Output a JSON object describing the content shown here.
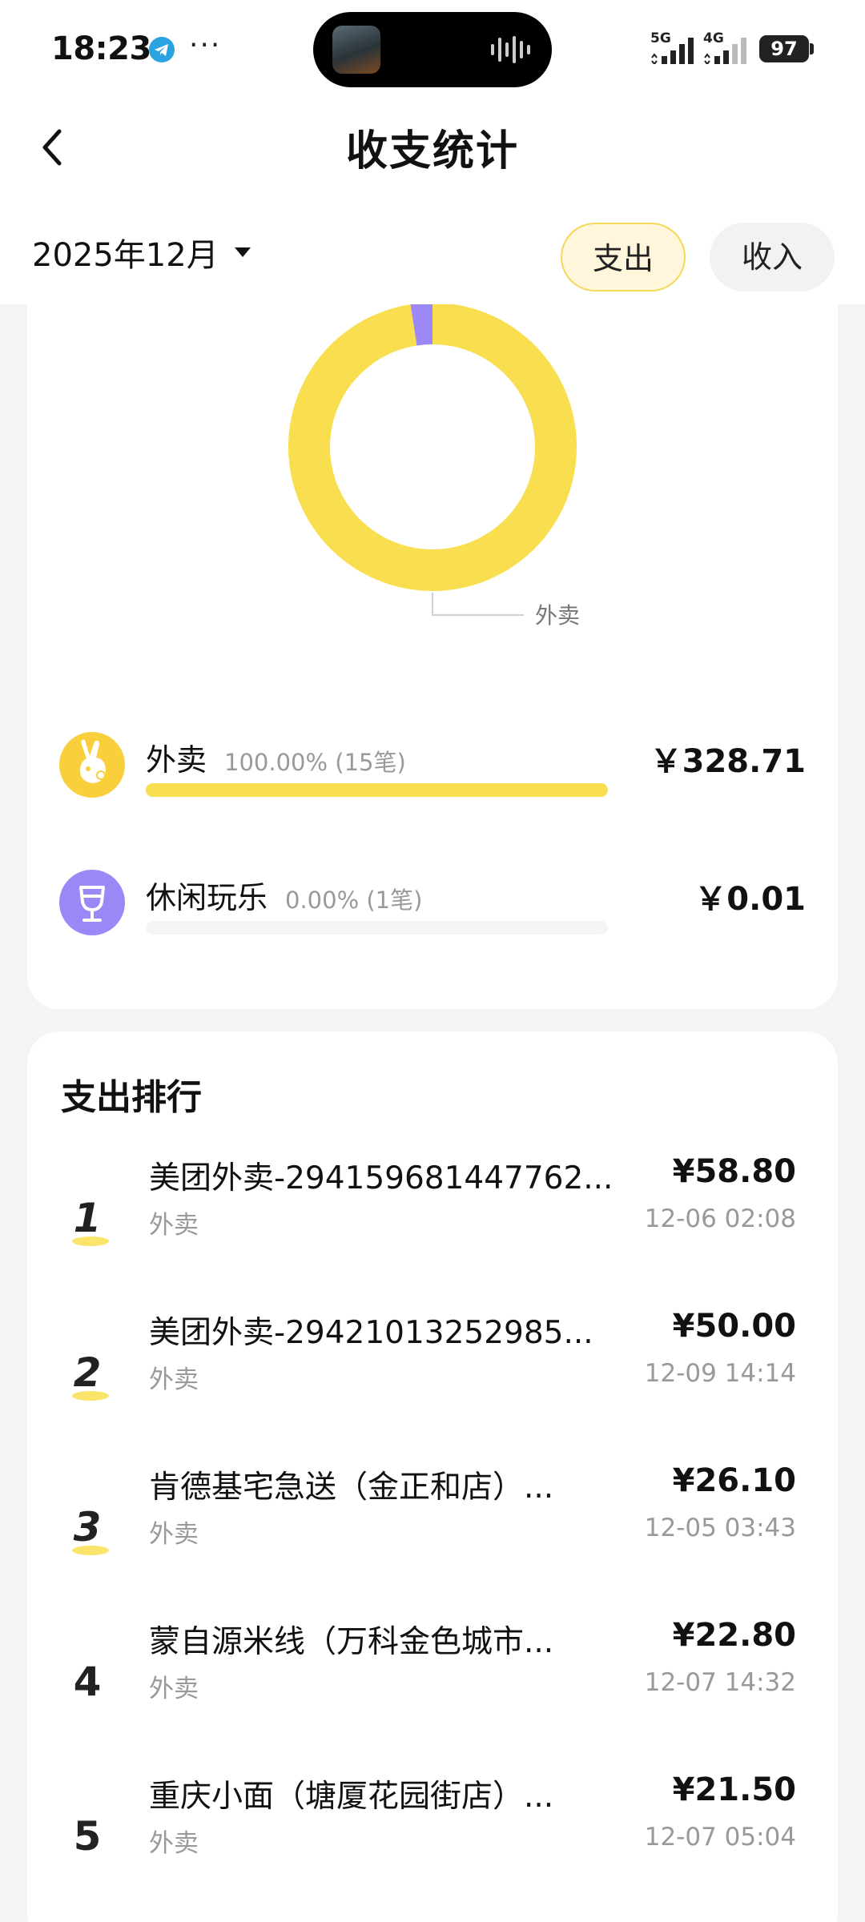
{
  "status_bar": {
    "time": "18:23",
    "dots": "···",
    "signal_1": "5G",
    "signal_2": "4G",
    "battery": "97"
  },
  "header": {
    "title": "收支统计",
    "month": "2025年12月",
    "tabs": [
      {
        "label": "支出",
        "selected": true
      },
      {
        "label": "收入",
        "selected": false
      }
    ]
  },
  "chart_data": {
    "type": "pie",
    "categories": [
      "外卖",
      "休闲玩乐"
    ],
    "values": [
      328.71,
      0.01
    ],
    "colors": [
      "#f9df4f",
      "#9b87f5"
    ],
    "annotation": "外卖"
  },
  "categories": [
    {
      "name": "外卖",
      "percent": "100.00% (15笔)",
      "percent_value": 100.0,
      "amount": "￥328.71",
      "color": "#f9df4f",
      "icon": "rabbit-icon"
    },
    {
      "name": "休闲玩乐",
      "percent": "0.00% (1笔)",
      "percent_value": 0.0,
      "amount": "￥0.01",
      "color": "#9b87f5",
      "icon": "wine-glass-icon"
    }
  ],
  "ranking": {
    "title": "支出排行",
    "items": [
      {
        "rank": "1",
        "name": "美团外卖-294159681447762...",
        "category": "外卖",
        "amount": "¥58.80",
        "time": "12-06 02:08"
      },
      {
        "rank": "2",
        "name": "美团外卖-29421013252985...",
        "category": "外卖",
        "amount": "¥50.00",
        "time": "12-09 14:14"
      },
      {
        "rank": "3",
        "name": "肯德基宅急送（金正和店）...",
        "category": "外卖",
        "amount": "¥26.10",
        "time": "12-05 03:43"
      },
      {
        "rank": "4",
        "name": "蒙自源米线（万科金色城市...",
        "category": "外卖",
        "amount": "¥22.80",
        "time": "12-07 14:32"
      },
      {
        "rank": "5",
        "name": "重庆小面（塘厦花园街店）...",
        "category": "外卖",
        "amount": "¥21.50",
        "time": "12-07 05:04"
      }
    ]
  }
}
